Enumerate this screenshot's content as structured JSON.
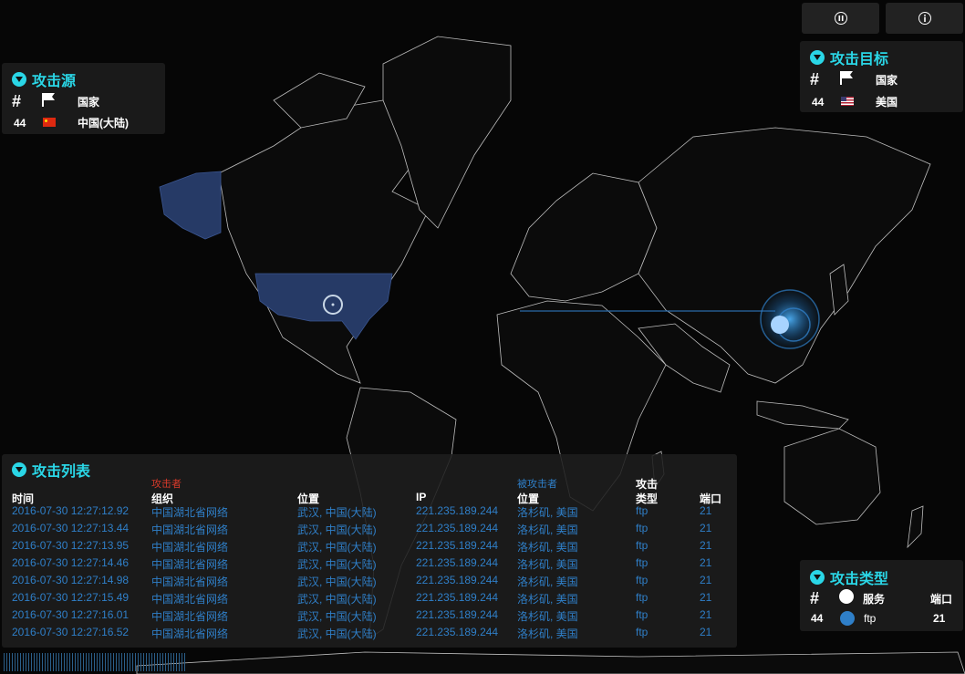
{
  "colors": {
    "accent": "#2ad6e6",
    "land": "#0b0b0b",
    "highlight_country": "#263a66",
    "link": "#2f7fc8",
    "attacker_label": "#d83a2a",
    "target_label": "#2f7fc8"
  },
  "toolbar": {
    "pause_icon": "pause-icon",
    "info_icon": "info-icon"
  },
  "source_panel": {
    "title": "攻击源",
    "col_country": "国家",
    "rows": [
      {
        "count": "44",
        "flag": "cn-flag",
        "country": "中国(大陆)"
      }
    ]
  },
  "target_panel": {
    "title": "攻击目标",
    "col_country": "国家",
    "rows": [
      {
        "count": "44",
        "flag": "us-flag",
        "country": "美国"
      }
    ]
  },
  "type_panel": {
    "title": "攻击类型",
    "col_service": "服务",
    "col_port": "端口",
    "rows": [
      {
        "count": "44",
        "service": "ftp",
        "port": "21",
        "dot_color": "#2f7fc8"
      }
    ]
  },
  "attack_list": {
    "title": "攻击列表",
    "attacker_group": "攻击者",
    "target_group": "被攻击者",
    "headers": {
      "time": "时间",
      "org": "组织",
      "src_location": "位置",
      "ip": "IP",
      "dst_location": "位置",
      "type_line1": "攻击",
      "type_line2": "类型",
      "port": "端口"
    },
    "rows": [
      {
        "time": "2016-07-30   12:27:12.92",
        "org": "中国湖北省网络",
        "src": "武汉, 中国(大陆)",
        "ip": "221.235.189.244",
        "dst": "洛杉矶, 美国",
        "type": "ftp",
        "port": "21"
      },
      {
        "time": "2016-07-30   12:27:13.44",
        "org": "中国湖北省网络",
        "src": "武汉, 中国(大陆)",
        "ip": "221.235.189.244",
        "dst": "洛杉矶, 美国",
        "type": "ftp",
        "port": "21"
      },
      {
        "time": "2016-07-30   12:27:13.95",
        "org": "中国湖北省网络",
        "src": "武汉, 中国(大陆)",
        "ip": "221.235.189.244",
        "dst": "洛杉矶, 美国",
        "type": "ftp",
        "port": "21"
      },
      {
        "time": "2016-07-30   12:27:14.46",
        "org": "中国湖北省网络",
        "src": "武汉, 中国(大陆)",
        "ip": "221.235.189.244",
        "dst": "洛杉矶, 美国",
        "type": "ftp",
        "port": "21"
      },
      {
        "time": "2016-07-30   12:27:14.98",
        "org": "中国湖北省网络",
        "src": "武汉, 中国(大陆)",
        "ip": "221.235.189.244",
        "dst": "洛杉矶, 美国",
        "type": "ftp",
        "port": "21"
      },
      {
        "time": "2016-07-30   12:27:15.49",
        "org": "中国湖北省网络",
        "src": "武汉, 中国(大陆)",
        "ip": "221.235.189.244",
        "dst": "洛杉矶, 美国",
        "type": "ftp",
        "port": "21"
      },
      {
        "time": "2016-07-30   12:27:16.01",
        "org": "中国湖北省网络",
        "src": "武汉, 中国(大陆)",
        "ip": "221.235.189.244",
        "dst": "洛杉矶, 美国",
        "type": "ftp",
        "port": "21"
      },
      {
        "time": "2016-07-30   12:27:16.52",
        "org": "中国湖北省网络",
        "src": "武汉, 中国(大陆)",
        "ip": "221.235.189.244",
        "dst": "洛杉矶, 美国",
        "type": "ftp",
        "port": "21"
      }
    ]
  }
}
